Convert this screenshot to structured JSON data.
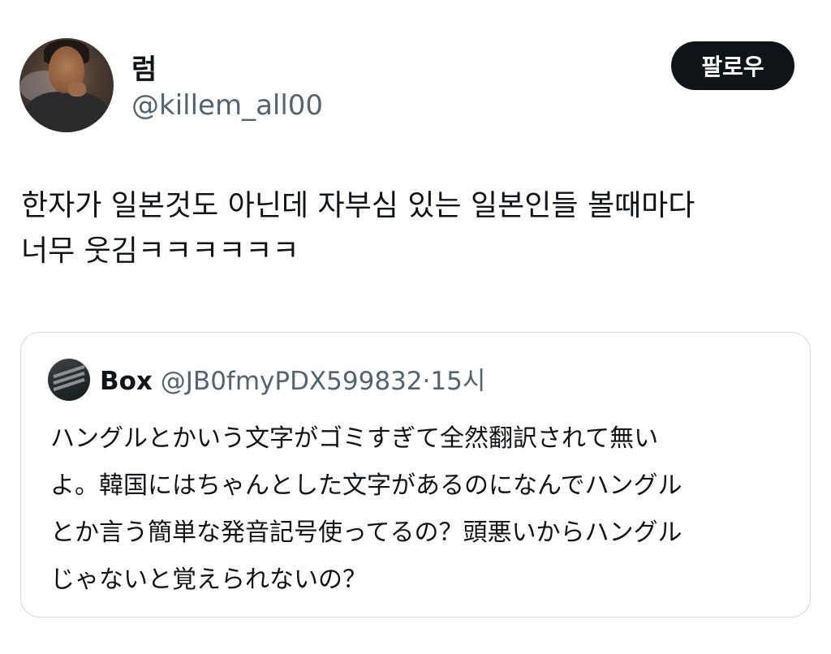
{
  "tweet": {
    "display_name": "럼",
    "handle": "@killem_all00",
    "follow_label": "팔로우",
    "text_line1": "한자가 일본것도 아닌데 자부심 있는 일본인들 볼때마다",
    "text_line2": "너무 웃김ㅋㅋㅋㅋㅋㅋ"
  },
  "quote": {
    "display_name": "Box",
    "handle": "@JB0fmyPDX599832",
    "separator": "·",
    "time": "15시",
    "lines": [
      "ハングルとかいう文字がゴミすぎて全然翻訳されて無い",
      "よ。韓国にはちゃんとした文字があるのになんでハングル",
      "とか言う簡単な発音記号使ってるの？頭悪いからハングル",
      "じゃないと覚えられないの？"
    ]
  }
}
